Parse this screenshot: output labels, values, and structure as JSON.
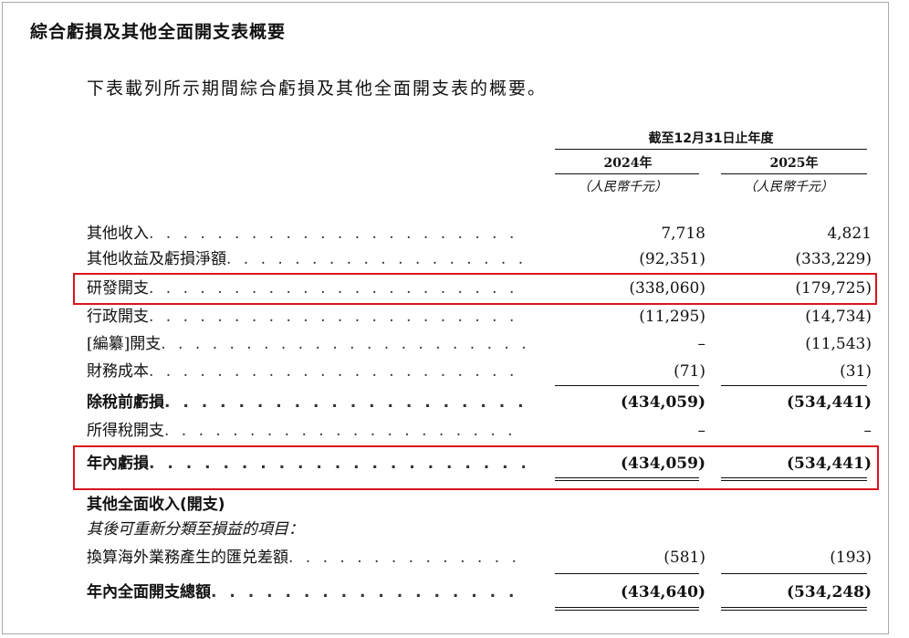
{
  "section_title": "綜合虧損及其他全面開支表概要",
  "intro_text": "下表載列所示期間綜合虧損及其他全面開支表的概要。",
  "header": {
    "period": "截至12月31日止年度",
    "year_1": "2024年",
    "year_2": "2025年",
    "unit_1": "（人民幣千元）",
    "unit_2": "（人民幣千元）"
  },
  "rows": [
    {
      "label": "其他收入",
      "v2024": "7,718",
      "v2025": "4,821"
    },
    {
      "label": "其他收益及虧損淨額",
      "v2024": "(92,351)",
      "v2025": "(333,229)"
    },
    {
      "label": "研發開支",
      "v2024": "(338,060)",
      "v2025": "(179,725)"
    },
    {
      "label": "行政開支",
      "v2024": "(11,295)",
      "v2025": "(14,734)"
    },
    {
      "label": "[編纂]開支",
      "v2024": "–",
      "v2025": "(11,543)"
    },
    {
      "label": "財務成本",
      "v2024": "(71)",
      "v2025": "(31)"
    },
    {
      "label": "除稅前虧損",
      "v2024": "(434,059)",
      "v2025": "(534,441)"
    },
    {
      "label": "所得稅開支",
      "v2024": "–",
      "v2025": "–"
    },
    {
      "label": "年內虧損",
      "v2024": "(434,059)",
      "v2025": "(534,441)"
    },
    {
      "label": "其他全面收入(開支)"
    },
    {
      "label": "其後可重新分類至損益的項目："
    },
    {
      "label": "換算海外業務產生的匯兑差額",
      "v2024": "(581)",
      "v2025": "(193)"
    },
    {
      "label": "年內全面開支總額",
      "v2024": "(434,640)",
      "v2025": "(534,248)"
    }
  ],
  "dot_leader": ". . . . . . . . . . . . . . . . . . . . . . . . . . . . . . . . . . . . . . . . . . . . . . . . . . . . . . . . . . . .",
  "highlight_color": "#d9141e"
}
